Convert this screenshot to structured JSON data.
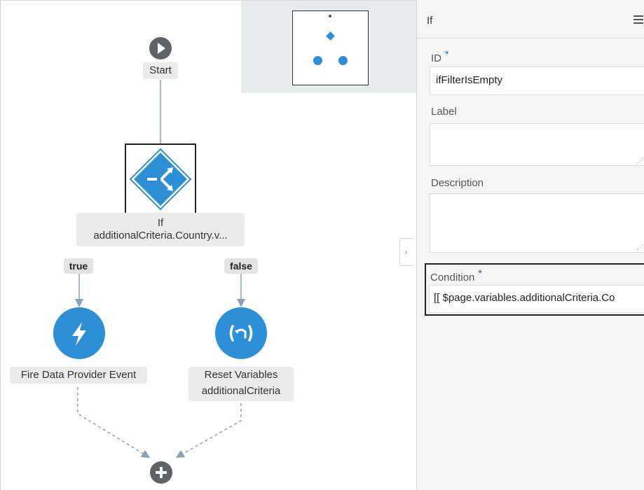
{
  "canvas": {
    "start_label": "Start",
    "if_label_line1": "If",
    "if_label_line2": "additionalCriteria.Country.v...",
    "true_branch": "true",
    "false_branch": "false",
    "fire_event_label": "Fire Data Provider Event",
    "reset_label_line1": "Reset Variables",
    "reset_label_line2": "additionalCriteria",
    "reset_icon_text": "(↶)"
  },
  "panel": {
    "title": "If",
    "id_label": "ID",
    "id_value": "ifFilterIsEmpty",
    "label_label": "Label",
    "label_value": "",
    "description_label": "Description",
    "description_value": "",
    "condition_label": "Condition",
    "condition_value": "[[ $page.variables.additionalCriteria.Co",
    "required_mark": "*"
  },
  "colors": {
    "accent": "#2d8fd5",
    "node_gray": "#5f6368",
    "minimap_bg": "#e6ecec",
    "panel_bg": "#f5f5f5",
    "required": "#0572ce"
  },
  "icons": [
    "play-icon",
    "switch-icon",
    "lightning-icon",
    "undo-icon",
    "plus-icon",
    "chevron-right-icon",
    "hamburger-menu-icon"
  ]
}
